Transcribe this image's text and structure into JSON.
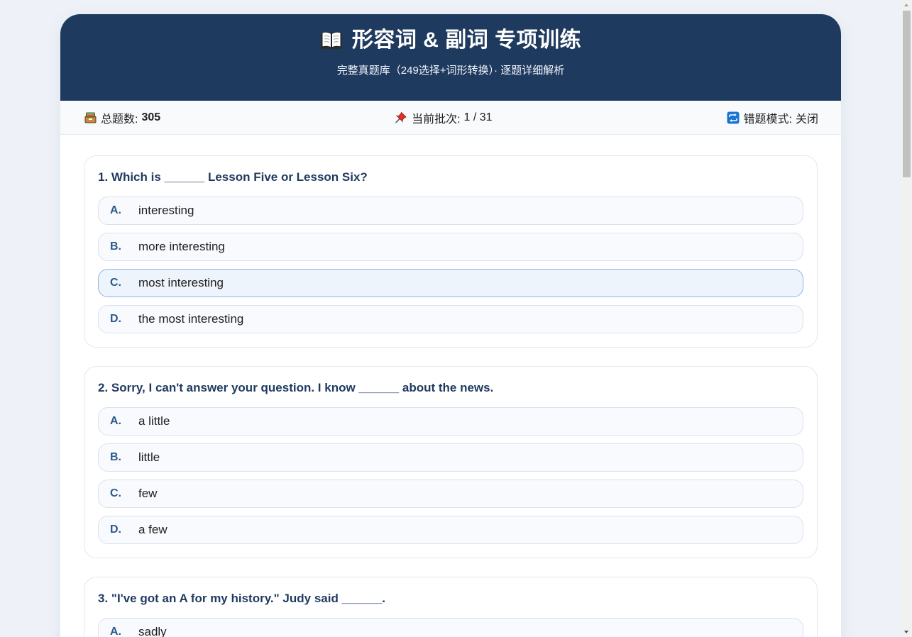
{
  "header": {
    "icon": "book-icon",
    "title": "形容词 & 副词 专项训练",
    "subtitle": "完整真题库（249选择+词形转换）· 逐题详细解析"
  },
  "stats": {
    "total": {
      "icon": "card-file-box-icon",
      "label": "总题数:",
      "value": "305"
    },
    "batch": {
      "icon": "pushpin-icon",
      "label": "当前批次:",
      "value": "1 / 31"
    },
    "wrong_mode": {
      "icon": "repeat-icon",
      "label": "错题模式:",
      "value": "关闭"
    }
  },
  "questions": [
    {
      "prompt": "1. Which is ______ Lesson Five or Lesson Six?",
      "options": [
        {
          "letter": "A.",
          "text": "interesting"
        },
        {
          "letter": "B.",
          "text": "more interesting"
        },
        {
          "letter": "C.",
          "text": "most interesting",
          "highlighted": true
        },
        {
          "letter": "D.",
          "text": "the most interesting"
        }
      ]
    },
    {
      "prompt": "2. Sorry, I can't answer your question. I know ______ about the news.",
      "options": [
        {
          "letter": "A.",
          "text": "a little"
        },
        {
          "letter": "B.",
          "text": "little"
        },
        {
          "letter": "C.",
          "text": "few"
        },
        {
          "letter": "D.",
          "text": "a few"
        }
      ]
    },
    {
      "prompt": "3. \"I've got an A for my history.\" Judy said ______.",
      "options": [
        {
          "letter": "A.",
          "text": "sadly"
        }
      ]
    }
  ],
  "colors": {
    "page_background": "#eef2f8",
    "header_background": "#1f3a5f",
    "question_text": "#1f3a5f",
    "option_letter": "#2c5a8c",
    "option_highlight_border": "#8fb3e3",
    "option_highlight_background": "#eef4fc"
  }
}
